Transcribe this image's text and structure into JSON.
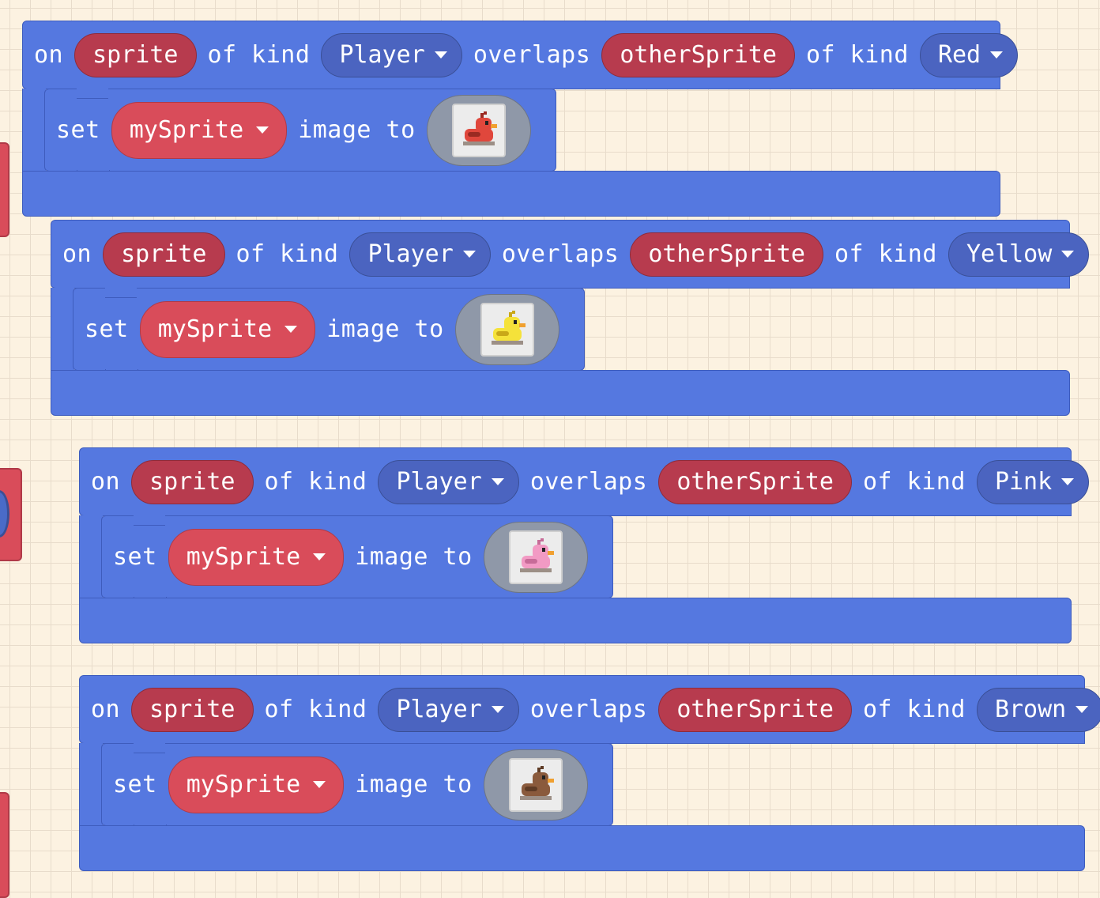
{
  "colors": {
    "background": "#fcf2e1",
    "event_block": "#5578e0",
    "variable_pill": "#b73b4e",
    "set_pill": "#d94c5a",
    "dropdown_pill": "#4b64c0"
  },
  "events": [
    {
      "on": "on",
      "sprite_var": "sprite",
      "of_kind_1": "of kind",
      "kind_1": "Player",
      "overlaps": "overlaps",
      "other_var": "otherSprite",
      "of_kind_2": "of kind",
      "kind_2": "Red",
      "set": "set",
      "set_var": "mySprite",
      "image_to": "image to",
      "duck_icon": "red-duck-icon",
      "duck_color": "#e0473c",
      "duck_dark": "#9b2a22"
    },
    {
      "on": "on",
      "sprite_var": "sprite",
      "of_kind_1": "of kind",
      "kind_1": "Player",
      "overlaps": "overlaps",
      "other_var": "otherSprite",
      "of_kind_2": "of kind",
      "kind_2": "Yellow",
      "set": "set",
      "set_var": "mySprite",
      "image_to": "image to",
      "duck_icon": "yellow-duck-icon",
      "duck_color": "#f5e23a",
      "duck_dark": "#c9a818"
    },
    {
      "on": "on",
      "sprite_var": "sprite",
      "of_kind_1": "of kind",
      "kind_1": "Player",
      "overlaps": "overlaps",
      "other_var": "otherSprite",
      "of_kind_2": "of kind",
      "kind_2": "Pink",
      "set": "set",
      "set_var": "mySprite",
      "image_to": "image to",
      "duck_icon": "pink-duck-icon",
      "duck_color": "#f29ac4",
      "duck_dark": "#c76b98"
    },
    {
      "on": "on",
      "sprite_var": "sprite",
      "of_kind_1": "of kind",
      "kind_1": "Player",
      "overlaps": "overlaps",
      "other_var": "otherSprite",
      "of_kind_2": "of kind",
      "kind_2": "Brown",
      "set": "set",
      "set_var": "mySprite",
      "image_to": "image to",
      "duck_icon": "brown-duck-icon",
      "duck_color": "#8a5a3c",
      "duck_dark": "#5e3b25"
    }
  ]
}
